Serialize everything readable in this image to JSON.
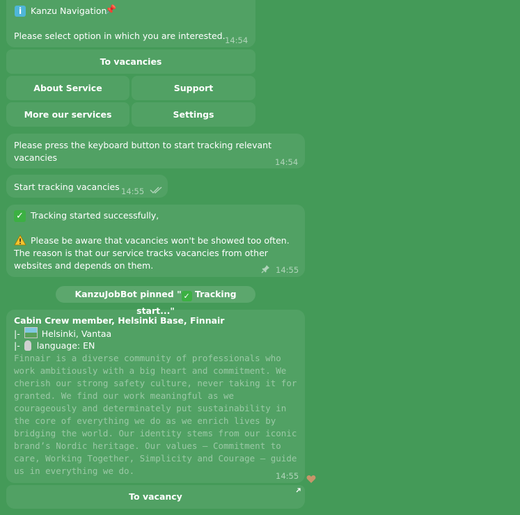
{
  "messages": {
    "nav": {
      "title": "Kanzu Navigation",
      "body": "Please select option in which you are interested.",
      "time": "14:54"
    },
    "keyboard_nav": {
      "to_vacancies": "To vacancies",
      "about_service": "About Service",
      "support": "Support",
      "more_services": "More our services",
      "settings": "Settings"
    },
    "press_keyboard": {
      "text": "Please press the keyboard button to start tracking relevant vacancies",
      "time": "14:54"
    },
    "outgoing": {
      "text": "Start tracking vacancies",
      "time": "14:55"
    },
    "tracking": {
      "line1": "Tracking started successfully,",
      "line2": "Please be aware that vacancies won't be showed too often. The reason is that our service tracks vacancies from other websites and depends on them.",
      "time": "14:55"
    },
    "pinned": {
      "text_before": "KanzuJobBot pinned \"",
      "text_after": " Tracking start...\""
    },
    "vacancy": {
      "title": "Cabin Crew member, Helsinki Base, Finnair",
      "location_prefix": "|-",
      "location": "Helsinki, Vantaa",
      "language_prefix": "|-",
      "language": "language: EN",
      "description": "Finnair is a diverse community of professionals who work ambitiously with a big heart and commitment. We cherish our strong safety culture, never taking it for granted. We find our work meaningful as we courageously and determinately put sustainability in the core of everything we do as we enrich lives by bridging the world. Our identity stems from our iconic brand’s Nordic heritage. Our values – Commitment to care, Working Together, Simplicity and Courage – guide us in everything we do.",
      "time": "14:55",
      "button": "To vacancy"
    }
  },
  "colors": {
    "background": "#449a58",
    "bubble": "rgba(255,255,255,0.075)",
    "check_green": "#3cb043",
    "warning_yellow": "#f4c430"
  }
}
